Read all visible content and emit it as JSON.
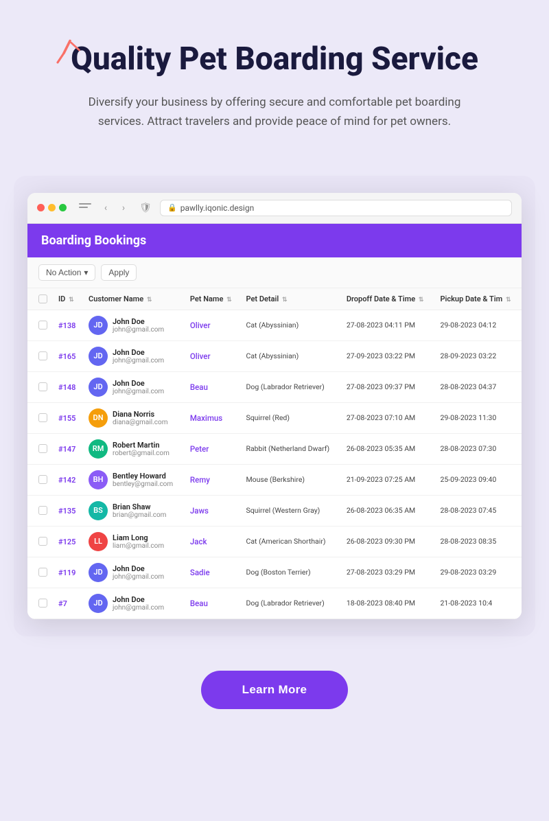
{
  "header": {
    "title": "Quality Pet Boarding Service",
    "subtitle": "Diversify your business by offering secure and comfortable pet boarding services. Attract travelers and provide peace of mind for pet owners."
  },
  "browser": {
    "url": "pawlly.iqonic.design",
    "lock_icon": "🔒"
  },
  "table": {
    "title": "Boarding Bookings",
    "controls": {
      "no_action": "No Action",
      "apply": "Apply"
    },
    "columns": [
      "ID",
      "Customer Name",
      "Pet Name",
      "Pet Detail",
      "Dropoff Date & Time",
      "Pickup Date & Tim"
    ],
    "rows": [
      {
        "id": "#138",
        "name": "John Doe",
        "email": "john@gmail.com",
        "pet_name": "Oliver",
        "pet_detail": "Cat (Abyssinian)",
        "dropoff": "27-08-2023 04:11 PM",
        "pickup": "29-08-2023 04:12",
        "av_class": "av-blue",
        "av_initial": "JD"
      },
      {
        "id": "#165",
        "name": "John Doe",
        "email": "john@gmail.com",
        "pet_name": "Oliver",
        "pet_detail": "Cat (Abyssinian)",
        "dropoff": "27-09-2023 03:22 PM",
        "pickup": "28-09-2023 03:22",
        "av_class": "av-blue",
        "av_initial": "JD"
      },
      {
        "id": "#148",
        "name": "John Doe",
        "email": "john@gmail.com",
        "pet_name": "Beau",
        "pet_detail": "Dog (Labrador Retriever)",
        "dropoff": "27-08-2023 09:37 PM",
        "pickup": "28-08-2023 04:37",
        "av_class": "av-blue",
        "av_initial": "JD"
      },
      {
        "id": "#155",
        "name": "Diana Norris",
        "email": "diana@gmail.com",
        "pet_name": "Maximus",
        "pet_detail": "Squirrel (Red)",
        "dropoff": "27-08-2023 07:10 AM",
        "pickup": "29-08-2023 11:30",
        "av_class": "av-orange",
        "av_initial": "DN"
      },
      {
        "id": "#147",
        "name": "Robert Martin",
        "email": "robert@gmail.com",
        "pet_name": "Peter",
        "pet_detail": "Rabbit (Netherland Dwarf)",
        "dropoff": "26-08-2023 05:35 AM",
        "pickup": "28-08-2023 07:30",
        "av_class": "av-green",
        "av_initial": "RM"
      },
      {
        "id": "#142",
        "name": "Bentley Howard",
        "email": "bentley@gmail.com",
        "pet_name": "Remy",
        "pet_detail": "Mouse (Berkshire)",
        "dropoff": "21-09-2023 07:25 AM",
        "pickup": "25-09-2023 09:40",
        "av_class": "av-purple",
        "av_initial": "BH"
      },
      {
        "id": "#135",
        "name": "Brian Shaw",
        "email": "brian@gmail.com",
        "pet_name": "Jaws",
        "pet_detail": "Squirrel (Western Gray)",
        "dropoff": "26-08-2023 06:35 AM",
        "pickup": "28-08-2023 07:45",
        "av_class": "av-teal",
        "av_initial": "BS"
      },
      {
        "id": "#125",
        "name": "Liam Long",
        "email": "liam@gmail.com",
        "pet_name": "Jack",
        "pet_detail": "Cat (American Shorthair)",
        "dropoff": "26-08-2023 09:30 PM",
        "pickup": "28-08-2023 08:35",
        "av_class": "av-red",
        "av_initial": "LL"
      },
      {
        "id": "#119",
        "name": "John Doe",
        "email": "john@gmail.com",
        "pet_name": "Sadie",
        "pet_detail": "Dog (Boston Terrier)",
        "dropoff": "27-08-2023 03:29 PM",
        "pickup": "29-08-2023 03:29",
        "av_class": "av-blue",
        "av_initial": "JD"
      },
      {
        "id": "#7",
        "name": "John Doe",
        "email": "john@gmail.com",
        "pet_name": "Beau",
        "pet_detail": "Dog (Labrador Retriever)",
        "dropoff": "18-08-2023 08:40 PM",
        "pickup": "21-08-2023 10:4",
        "av_class": "av-blue",
        "av_initial": "JD"
      }
    ]
  },
  "cta": {
    "label": "Learn More"
  }
}
